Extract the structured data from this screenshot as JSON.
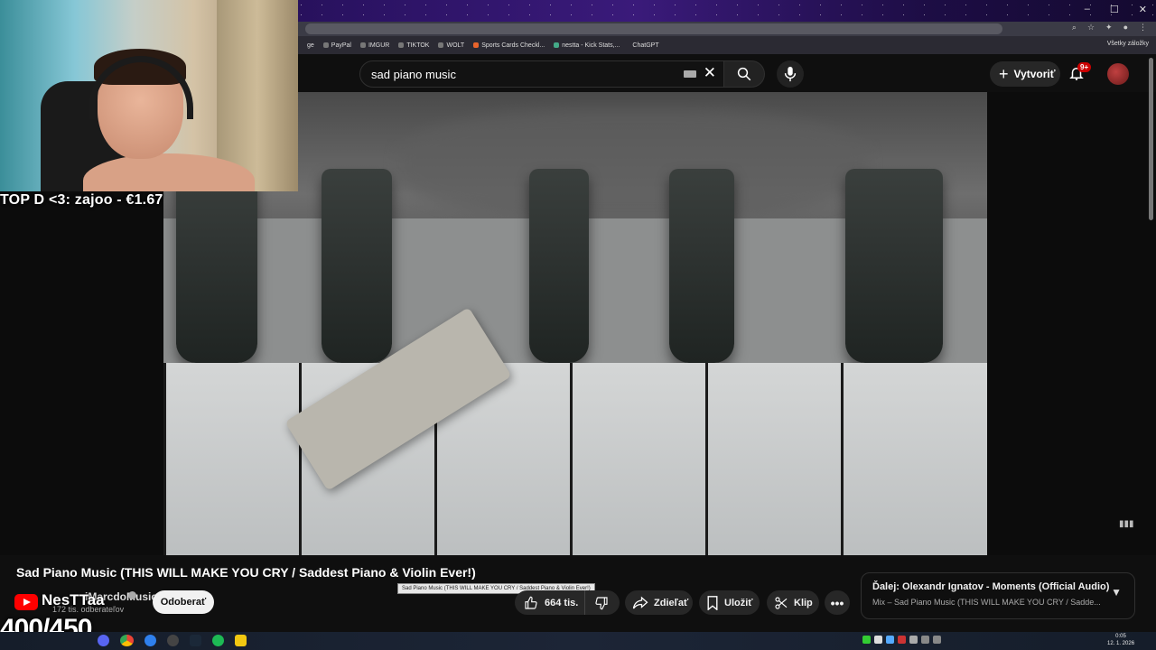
{
  "browser": {
    "window_controls": [
      "–",
      "☐",
      "✕"
    ],
    "bookmarks": [
      "ge",
      "PayPal",
      "IMGUR",
      "TIKTOK",
      "WOLT",
      "Sports Cards Checkl...",
      "nestta - Kick Stats,...",
      "ChatGPT"
    ],
    "all_bookmarks": "Všetky záložky"
  },
  "yt_header": {
    "search_value": "sad piano music",
    "create_label": "Vytvoriť",
    "notification_badge": "9+"
  },
  "stream_overlay": {
    "top_donation": "TOP D <3: zajoo - €1.67",
    "streamer_name": "NesTTaa",
    "counter": "400/450"
  },
  "video": {
    "title": "Sad Piano Music (THIS WILL MAKE YOU CRY / Saddest Piano & Violin Ever!)",
    "channel": "iMarcdoMusic",
    "subscribers": "172 tis. odberateľov",
    "subscribe_label": "Odoberať",
    "likes": "664 tis.",
    "share_label": "Zdieľať",
    "save_label": "Uložiť",
    "clip_label": "Klip",
    "tooltip": "Sad Piano Music (THIS WILL MAKE YOU CRY / Saddest Piano & Violin Ever!)"
  },
  "up_next": {
    "title": "Ďalej: Olexandr Ignatov - Moments (Official Audio)",
    "subtitle": "Mix – Sad Piano Music (THIS WILL MAKE YOU CRY / Sadde..."
  },
  "taskbar": {
    "time": "0:05",
    "date": "12. 1. 2026"
  },
  "colors": {
    "yt_red": "#ff0000",
    "background": "#0f0f0f",
    "button_bg": "#272727"
  }
}
